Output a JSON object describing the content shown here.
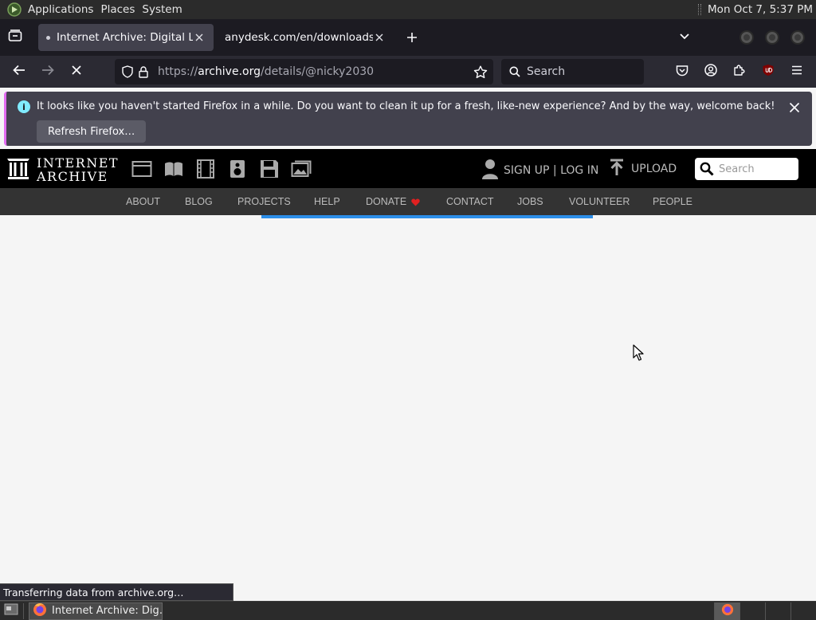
{
  "top_panel": {
    "applications": "Applications",
    "places": "Places",
    "system": "System",
    "clock": "Mon Oct  7,  5:37 PM"
  },
  "tabs": [
    {
      "title": "Internet Archive: Digital Libr",
      "active": true,
      "loading": true
    },
    {
      "title": "anydesk.com/en/downloads/wi",
      "active": false
    }
  ],
  "nav": {
    "url_scheme": "https://",
    "url_host": "archive.org",
    "url_path": "/details/@nicky2030",
    "search_placeholder": "Search"
  },
  "notification": {
    "message": "It looks like you haven't started Firefox in a while. Do you want to clean it up for a fresh, like-new experience? And by the way, welcome back!",
    "button": "Refresh Firefox…"
  },
  "ia_header": {
    "wordmark_line1": "INTERNET",
    "wordmark_line2": "ARCHIVE",
    "sign_up_login": "SIGN UP | LOG IN",
    "upload": "UPLOAD",
    "search_placeholder": "Search"
  },
  "ia_nav": [
    "ABOUT",
    "BLOG",
    "PROJECTS",
    "HELP",
    "DONATE",
    "CONTACT",
    "JOBS",
    "VOLUNTEER",
    "PEOPLE"
  ],
  "status_text": "Transferring data from archive.org…",
  "taskbar": {
    "window_title": "Internet Archive: Dig…"
  },
  "colors": {
    "ia_progress": "#2c8ee8",
    "notification_accent": "#e26cf0",
    "donate_heart": "#e02020"
  }
}
